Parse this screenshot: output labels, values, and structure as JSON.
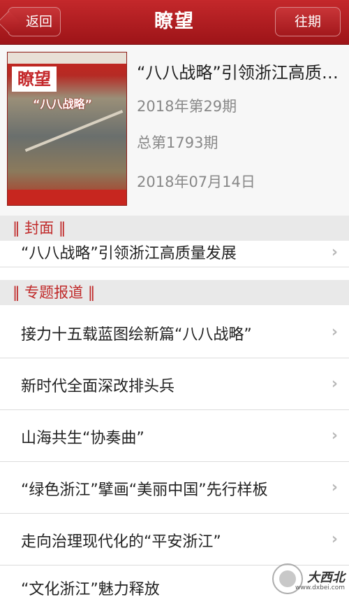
{
  "header": {
    "back_label": "返回",
    "title": "瞭望",
    "past_label": "往期"
  },
  "issue": {
    "cover_logo": "瞭望",
    "cover_headline": "“八八战略”",
    "title": "“八八战略”引领浙江高质量发展",
    "issue_no": "2018年第29期",
    "total_no": "总第1793期",
    "date": "2018年07月14日"
  },
  "sections": [
    {
      "label": "‖ 封面 ‖",
      "items": [
        "“八八战略”引领浙江高质量发展"
      ]
    },
    {
      "label": "‖ 专题报道 ‖",
      "items": [
        "接力十五载蓝图绘新篇“八八战略”",
        "新时代全面深改排头兵",
        "山海共生“协奏曲”",
        "“绿色浙江”擘画“美丽中国”先行样板",
        "走向治理现代化的“平安浙江”",
        "“文化浙江”魅力释放"
      ]
    }
  ],
  "chevron": "›",
  "watermark": {
    "cn": "大西北",
    "url": "www.dxbei.com"
  },
  "colors": {
    "brand_red": "#b01c20",
    "section_text": "#c02a2a",
    "section_bg": "#e9e9e9"
  },
  "icons": [
    "back-arrow-icon",
    "chevron-right-icon"
  ]
}
